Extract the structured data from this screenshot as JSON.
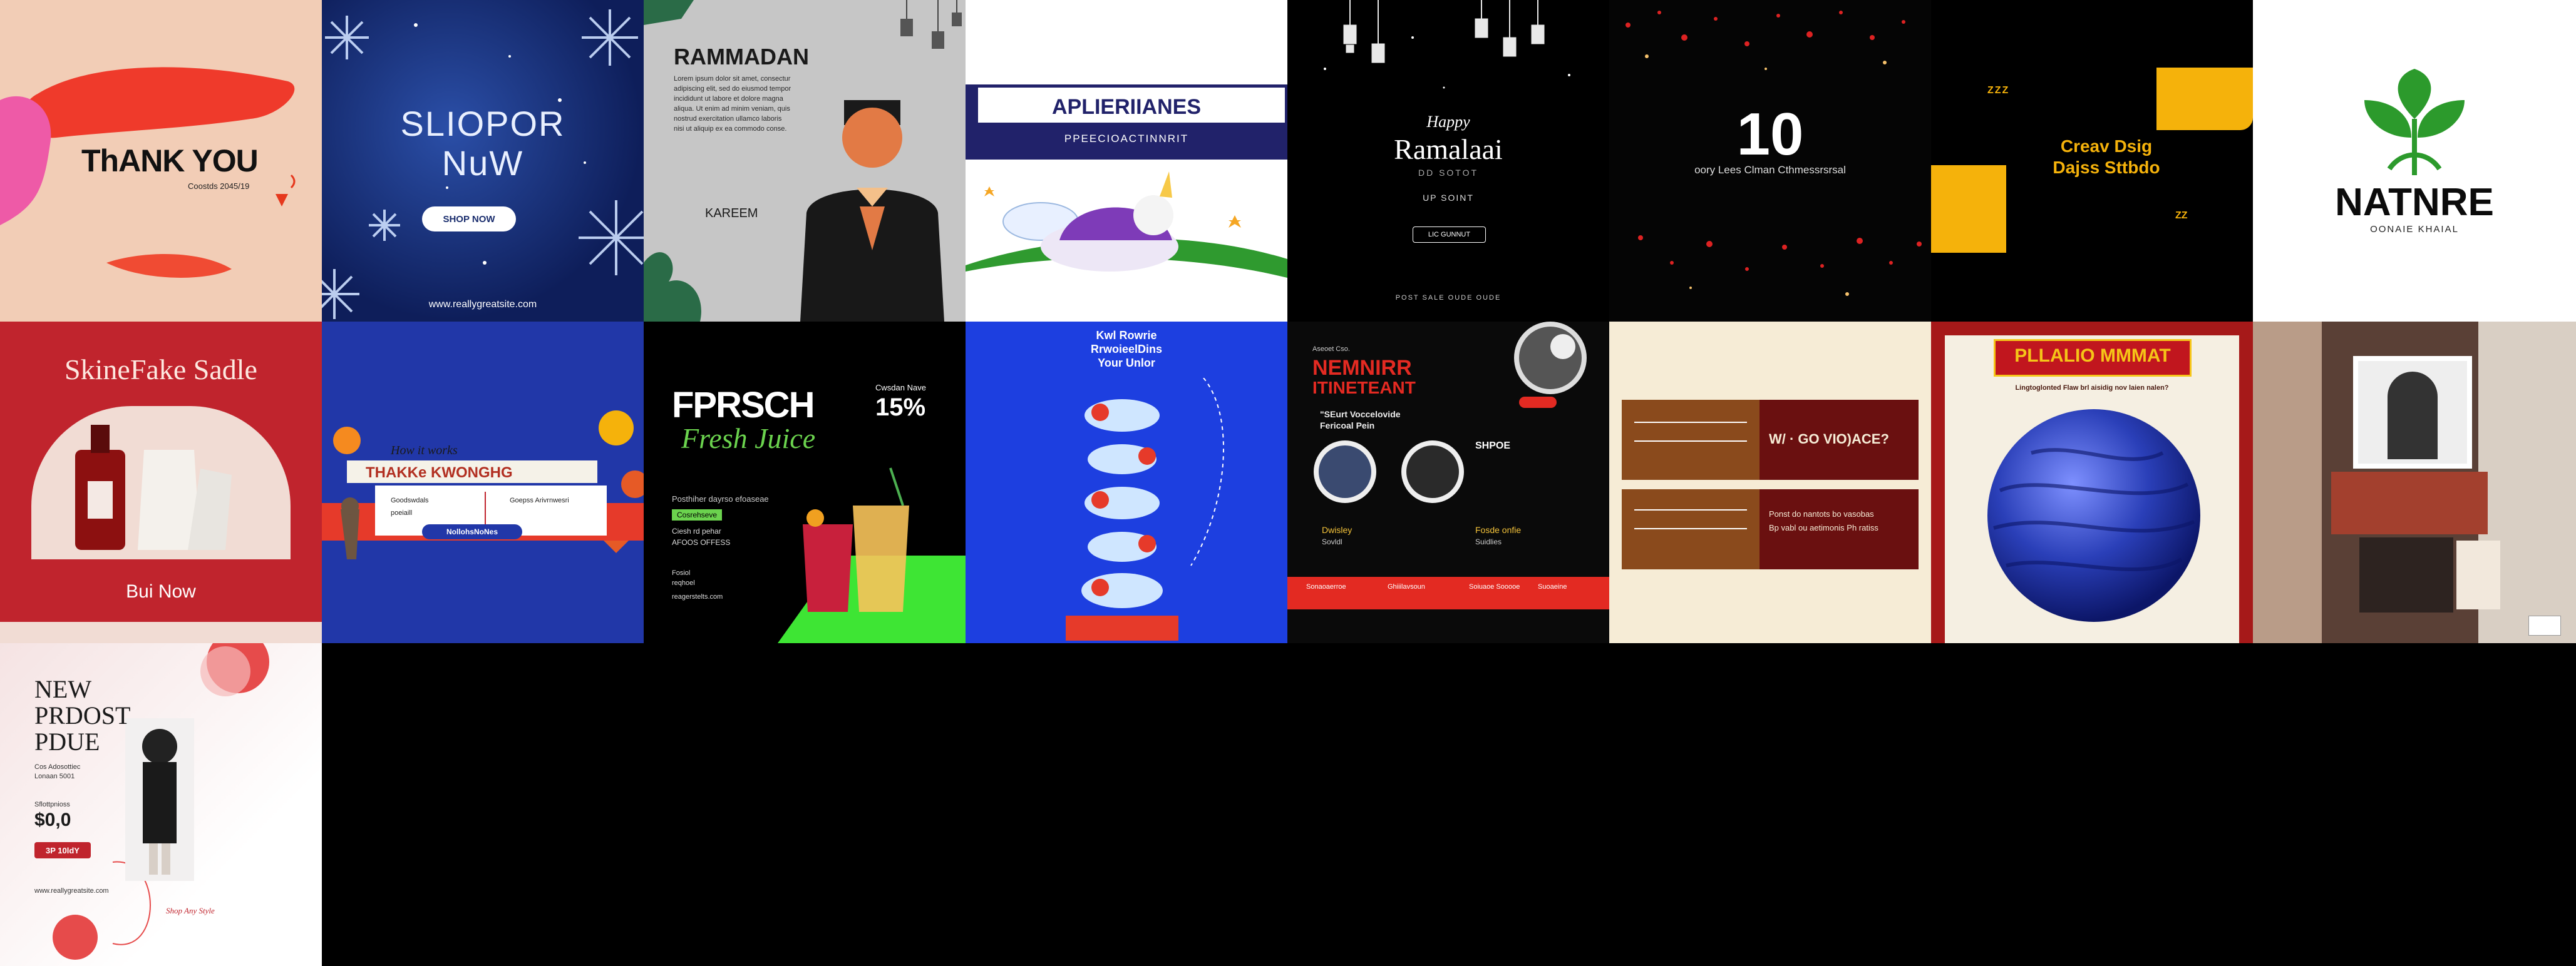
{
  "tiles": {
    "thank_you": {
      "title": "ThANK YOU",
      "subtitle": "Coostds 2045/19"
    },
    "shop_now": {
      "title_line1": "SLIOPOR",
      "title_line2": "NuW",
      "button": "SHOP NOW",
      "url": "www.reallygreatsite.com"
    },
    "ramadan_man": {
      "title": "RAMMADAN",
      "body": [
        "Lorem ipsum dolor sit amet, consectur",
        "adipiscing elit, sed do eiusmod tempor",
        "incididunt ut labore et dolore magna",
        "aliqua. Ut enim ad minim veniam, quis",
        "nostrud exercitation ullamco laboris",
        "nisi ut aliquip ex ea commodo conse."
      ],
      "signature": "KAREEM"
    },
    "appliances": {
      "title": "APLIERIIANES",
      "subtitle": "PPEECIOACTINNRIT"
    },
    "happy_ramadan": {
      "line1": "Happy",
      "line2": "Ramalaai",
      "line3": "DD SOTOT",
      "line4": "UP SOINT",
      "button": "LIC GUNNUT",
      "footer": "POST SALE OUDE OUDE"
    },
    "ten_year": {
      "number": "10",
      "caption": "oory Lees Clman Cthmessrsrsal"
    },
    "creative_design": {
      "line1": "Creav Dsig",
      "line2": "Dajss Sttbdo",
      "marks_top": "ZZZ",
      "marks_bottom": "ZZ"
    },
    "nature": {
      "title": "NATNRE",
      "subtitle": "OONAIE KHAIAL",
      "leaf_color": "#2c9a2c"
    },
    "skincare": {
      "title": "SkineFake Sadle",
      "button": "Bui Now"
    },
    "thanks_giving": {
      "script": "How it works",
      "banner": "THAKKe KWONGHG",
      "left_text": "Goodswdals",
      "left_sub": "poeiaill",
      "right_text": "Goepss Arivrnwesri",
      "pill": "NollohsNoNes"
    },
    "fresh_juice": {
      "title": "FPRSCH",
      "script": "Fresh Juice",
      "discount_label": "Cwsdan Nave",
      "discount": "15%",
      "body": "Posthiher dayrso efoaseae",
      "tag": "Cosrehseve",
      "line_a": "Ciesh rd pehar",
      "line_b": "AFOOS OFFESS",
      "contact_a": "Fosiol",
      "contact_b": "reqhoel",
      "site": "reagerstelts.com"
    },
    "remote_work": {
      "title_line1": "Kwl Rowrie",
      "title_line2": "RrwoieelDins",
      "title_line3": "Your Unlor"
    },
    "seminar": {
      "eyebrow": "Aseoet Cso.",
      "title_line1": "NEMNIRR",
      "title_line2": "ITINETEANT",
      "subtitle_line1": "\"SEurt Voccelovide",
      "subtitle_line2": "Fericoal Pein",
      "speaker_a": "Dwisley",
      "speaker_a_sub": "Sovldl",
      "speaker_b": "Fosde onfie",
      "speaker_b_sub": "Suidlies",
      "info": "SHPOE",
      "footer_a": "Sonaoaerroe",
      "footer_b": "Ghiiilavsoun",
      "footer_c": "Soiuaoe Sooooe",
      "footer_d": "Suoaeine"
    },
    "why_question": {
      "question": "W/ · GO VIO)ACE?",
      "body_a": "Ponst do nantots bo vasobas",
      "body_b": "Bp vabl ou aetimonis Ph ratiss"
    },
    "plaid_mat": {
      "title": "PLLALIO MMMAT",
      "subtitle": "Lingtoglonted Flaw brl aisidig nov laien nalen?",
      "sphere_color": "#2a3fb8"
    },
    "collage": {},
    "new_product": {
      "title_line1": "NEW",
      "title_line2": "PRDOST",
      "title_line3": "PDUE",
      "desc_a": "Cos Adosottiec",
      "desc_b": "Lonaan 5001",
      "price_label": "Sflottpnioss",
      "price": "$0,0",
      "cta": "3P 10ldY",
      "site": "www.reallygreatsite.com",
      "script": "Shop Any Style"
    }
  }
}
